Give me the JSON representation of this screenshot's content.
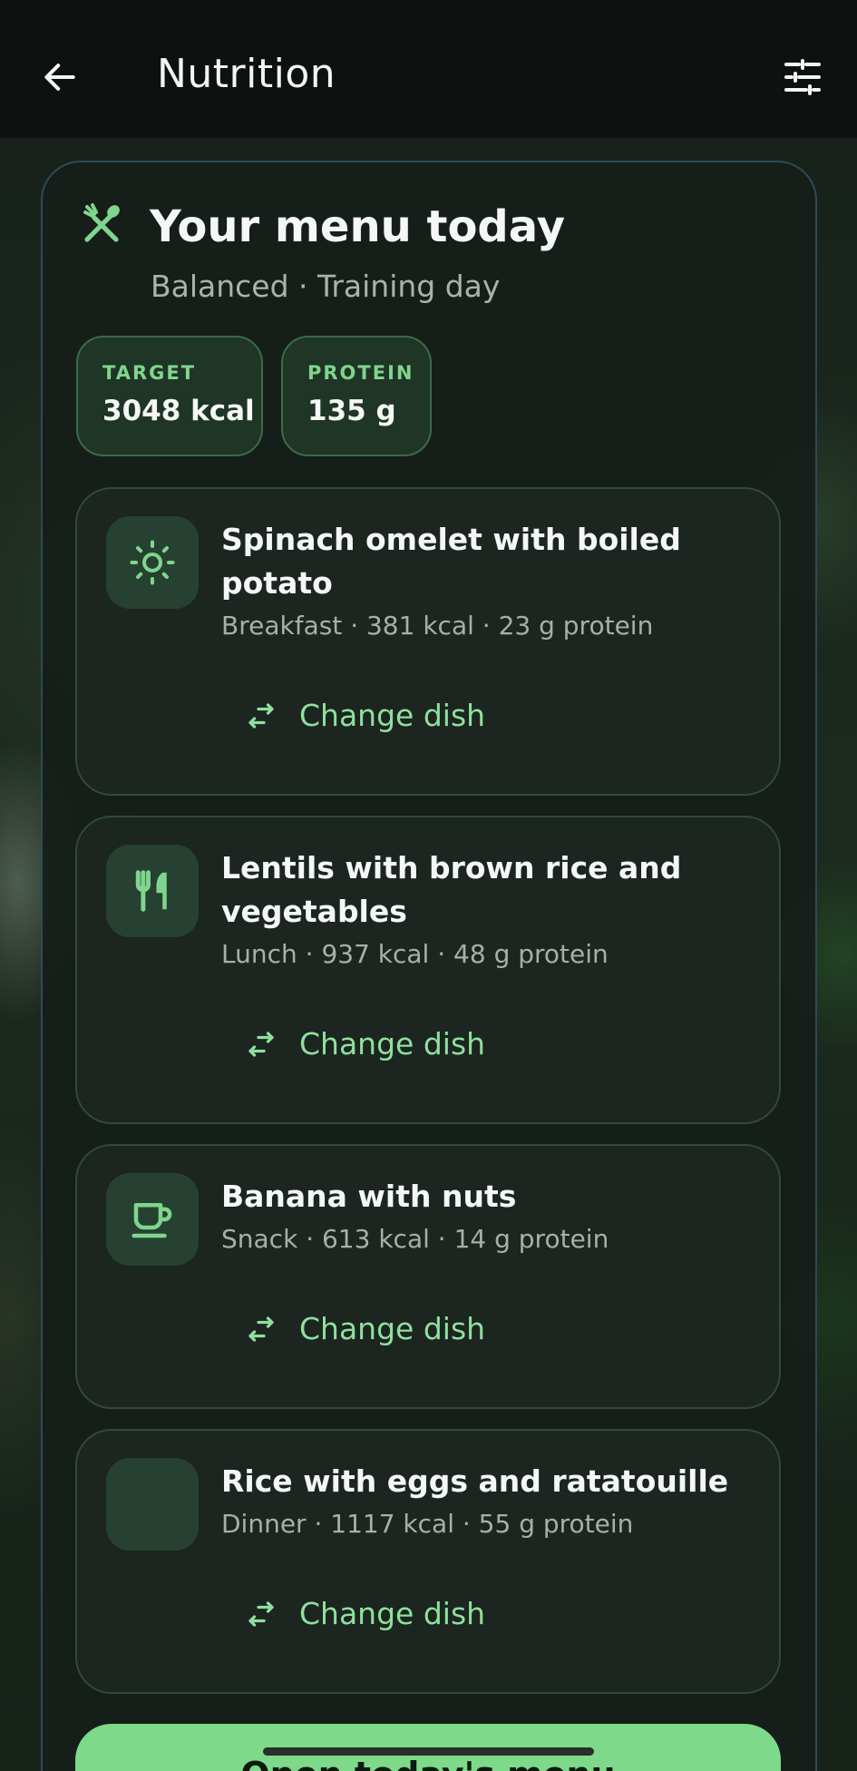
{
  "header": {
    "title": "Nutrition"
  },
  "menu": {
    "title": "Your menu today",
    "subtitle": "Balanced · Training day",
    "stats": [
      {
        "label": "TARGET",
        "value": "3048 kcal"
      },
      {
        "label": "PROTEIN",
        "value": "135 g"
      }
    ]
  },
  "meals": [
    {
      "icon": "sun-icon",
      "title": "Spinach omelet with boiled potato",
      "meta": "Breakfast · 381 kcal · 23 g protein",
      "action": "Change dish"
    },
    {
      "icon": "fork-knife-icon",
      "title": "Lentils with brown rice and vegetables",
      "meta": "Lunch · 937 kcal · 48 g protein",
      "action": "Change dish"
    },
    {
      "icon": "cup-icon",
      "title": "Banana with nuts",
      "meta": "Snack · 613 kcal · 14 g protein",
      "action": "Change dish"
    },
    {
      "icon": "moon-icon",
      "title": "Rice with eggs and ratatouille",
      "meta": "Dinner · 1117 kcal · 55 g protein",
      "action": "Change dish"
    }
  ],
  "primary_action": {
    "label": "Open today's menu"
  },
  "colors": {
    "accent": "#7ed98b",
    "background": "#0d1210",
    "card": "#1c2520"
  }
}
